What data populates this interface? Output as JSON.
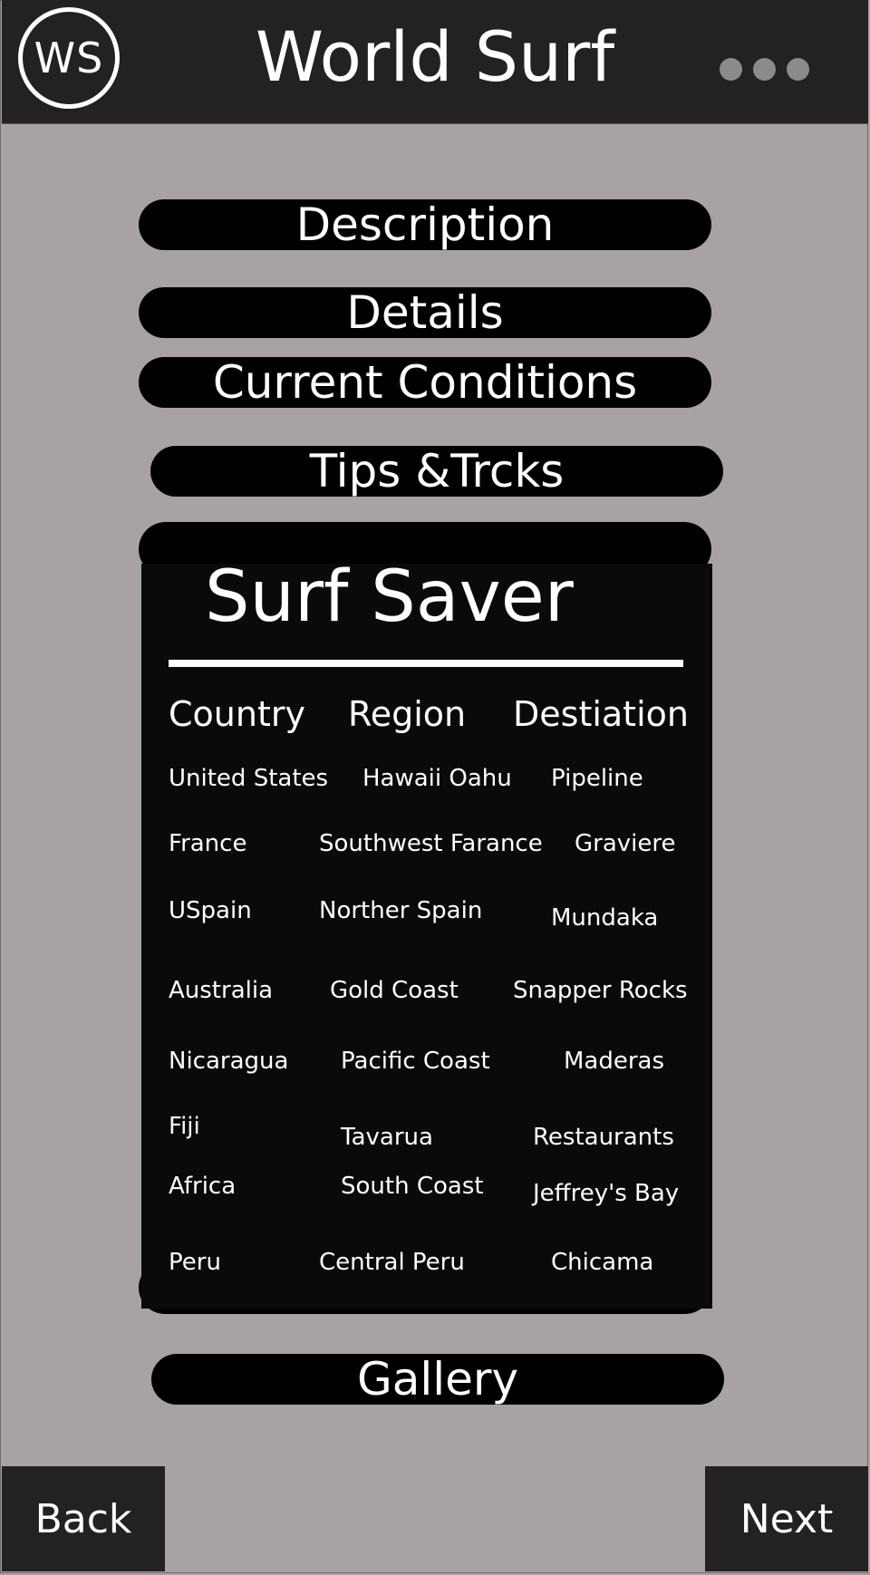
{
  "header": {
    "logo_text": "WS",
    "title": "World Surf",
    "more_icon": "more-horizontal-icon"
  },
  "menu": {
    "description": "Description",
    "details": "Details",
    "current_conditions": "Current Conditions",
    "tips_tricks": "Tips &Trcks",
    "gallery": "Gallery"
  },
  "surf_saver": {
    "title": "Surf Saver",
    "columns": [
      "Country",
      "Region",
      "Destiation"
    ],
    "rows": [
      [
        "United States",
        "Hawaii Oahu",
        "Pipeline"
      ],
      [
        "France",
        "Southwest Farance",
        "Graviere"
      ],
      [
        "USpain",
        "Norther Spain",
        "Mundaka"
      ],
      [
        "Australia",
        "Gold Coast",
        "Snapper Rocks"
      ],
      [
        "Nicaragua",
        "Pacific Coast",
        "Maderas"
      ],
      [
        "Fiji",
        "Tavarua",
        "Restaurants"
      ],
      [
        "Africa",
        "South Coast",
        "Jeffrey's Bay"
      ],
      [
        "Peru",
        "Central Peru",
        "Chicama"
      ]
    ]
  },
  "footer": {
    "back": "Back",
    "next": "Next"
  },
  "colors": {
    "background": "#a8a2a2",
    "header": "#232122",
    "pill": "#000000",
    "text": "#ffffff"
  }
}
